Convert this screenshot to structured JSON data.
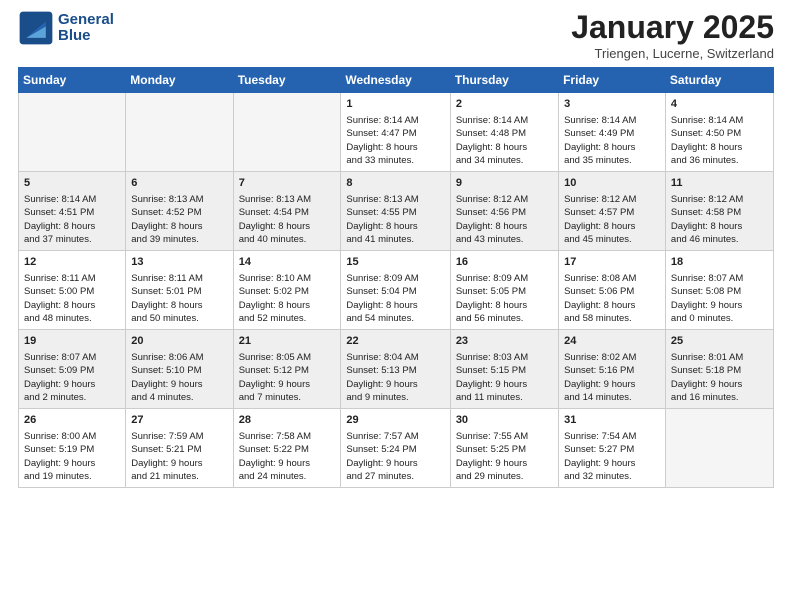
{
  "logo": {
    "name": "GeneralBlue",
    "line1": "General",
    "line2": "Blue"
  },
  "title": "January 2025",
  "subtitle": "Triengen, Lucerne, Switzerland",
  "weekdays": [
    "Sunday",
    "Monday",
    "Tuesday",
    "Wednesday",
    "Thursday",
    "Friday",
    "Saturday"
  ],
  "weeks": [
    [
      {
        "day": "",
        "info": ""
      },
      {
        "day": "",
        "info": ""
      },
      {
        "day": "",
        "info": ""
      },
      {
        "day": "1",
        "info": "Sunrise: 8:14 AM\nSunset: 4:47 PM\nDaylight: 8 hours\nand 33 minutes."
      },
      {
        "day": "2",
        "info": "Sunrise: 8:14 AM\nSunset: 4:48 PM\nDaylight: 8 hours\nand 34 minutes."
      },
      {
        "day": "3",
        "info": "Sunrise: 8:14 AM\nSunset: 4:49 PM\nDaylight: 8 hours\nand 35 minutes."
      },
      {
        "day": "4",
        "info": "Sunrise: 8:14 AM\nSunset: 4:50 PM\nDaylight: 8 hours\nand 36 minutes."
      }
    ],
    [
      {
        "day": "5",
        "info": "Sunrise: 8:14 AM\nSunset: 4:51 PM\nDaylight: 8 hours\nand 37 minutes."
      },
      {
        "day": "6",
        "info": "Sunrise: 8:13 AM\nSunset: 4:52 PM\nDaylight: 8 hours\nand 39 minutes."
      },
      {
        "day": "7",
        "info": "Sunrise: 8:13 AM\nSunset: 4:54 PM\nDaylight: 8 hours\nand 40 minutes."
      },
      {
        "day": "8",
        "info": "Sunrise: 8:13 AM\nSunset: 4:55 PM\nDaylight: 8 hours\nand 41 minutes."
      },
      {
        "day": "9",
        "info": "Sunrise: 8:12 AM\nSunset: 4:56 PM\nDaylight: 8 hours\nand 43 minutes."
      },
      {
        "day": "10",
        "info": "Sunrise: 8:12 AM\nSunset: 4:57 PM\nDaylight: 8 hours\nand 45 minutes."
      },
      {
        "day": "11",
        "info": "Sunrise: 8:12 AM\nSunset: 4:58 PM\nDaylight: 8 hours\nand 46 minutes."
      }
    ],
    [
      {
        "day": "12",
        "info": "Sunrise: 8:11 AM\nSunset: 5:00 PM\nDaylight: 8 hours\nand 48 minutes."
      },
      {
        "day": "13",
        "info": "Sunrise: 8:11 AM\nSunset: 5:01 PM\nDaylight: 8 hours\nand 50 minutes."
      },
      {
        "day": "14",
        "info": "Sunrise: 8:10 AM\nSunset: 5:02 PM\nDaylight: 8 hours\nand 52 minutes."
      },
      {
        "day": "15",
        "info": "Sunrise: 8:09 AM\nSunset: 5:04 PM\nDaylight: 8 hours\nand 54 minutes."
      },
      {
        "day": "16",
        "info": "Sunrise: 8:09 AM\nSunset: 5:05 PM\nDaylight: 8 hours\nand 56 minutes."
      },
      {
        "day": "17",
        "info": "Sunrise: 8:08 AM\nSunset: 5:06 PM\nDaylight: 8 hours\nand 58 minutes."
      },
      {
        "day": "18",
        "info": "Sunrise: 8:07 AM\nSunset: 5:08 PM\nDaylight: 9 hours\nand 0 minutes."
      }
    ],
    [
      {
        "day": "19",
        "info": "Sunrise: 8:07 AM\nSunset: 5:09 PM\nDaylight: 9 hours\nand 2 minutes."
      },
      {
        "day": "20",
        "info": "Sunrise: 8:06 AM\nSunset: 5:10 PM\nDaylight: 9 hours\nand 4 minutes."
      },
      {
        "day": "21",
        "info": "Sunrise: 8:05 AM\nSunset: 5:12 PM\nDaylight: 9 hours\nand 7 minutes."
      },
      {
        "day": "22",
        "info": "Sunrise: 8:04 AM\nSunset: 5:13 PM\nDaylight: 9 hours\nand 9 minutes."
      },
      {
        "day": "23",
        "info": "Sunrise: 8:03 AM\nSunset: 5:15 PM\nDaylight: 9 hours\nand 11 minutes."
      },
      {
        "day": "24",
        "info": "Sunrise: 8:02 AM\nSunset: 5:16 PM\nDaylight: 9 hours\nand 14 minutes."
      },
      {
        "day": "25",
        "info": "Sunrise: 8:01 AM\nSunset: 5:18 PM\nDaylight: 9 hours\nand 16 minutes."
      }
    ],
    [
      {
        "day": "26",
        "info": "Sunrise: 8:00 AM\nSunset: 5:19 PM\nDaylight: 9 hours\nand 19 minutes."
      },
      {
        "day": "27",
        "info": "Sunrise: 7:59 AM\nSunset: 5:21 PM\nDaylight: 9 hours\nand 21 minutes."
      },
      {
        "day": "28",
        "info": "Sunrise: 7:58 AM\nSunset: 5:22 PM\nDaylight: 9 hours\nand 24 minutes."
      },
      {
        "day": "29",
        "info": "Sunrise: 7:57 AM\nSunset: 5:24 PM\nDaylight: 9 hours\nand 27 minutes."
      },
      {
        "day": "30",
        "info": "Sunrise: 7:55 AM\nSunset: 5:25 PM\nDaylight: 9 hours\nand 29 minutes."
      },
      {
        "day": "31",
        "info": "Sunrise: 7:54 AM\nSunset: 5:27 PM\nDaylight: 9 hours\nand 32 minutes."
      },
      {
        "day": "",
        "info": ""
      }
    ]
  ],
  "shaded_rows": [
    1,
    3
  ]
}
